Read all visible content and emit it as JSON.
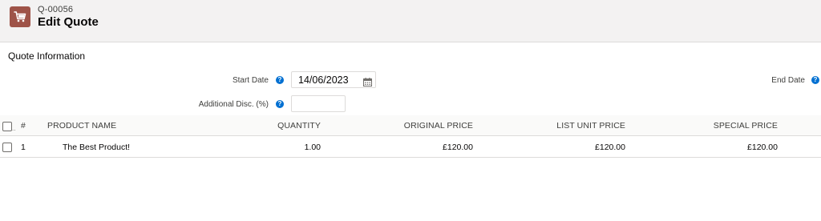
{
  "record": {
    "id": "Q-00056",
    "title": "Edit Quote",
    "icon": "cart-icon",
    "brand_color": "#9e5348"
  },
  "section": {
    "title": "Quote Information"
  },
  "fields": {
    "start_date": {
      "label": "Start Date",
      "value": "14/06/2023"
    },
    "end_date": {
      "label": "End Date"
    },
    "additional_disc": {
      "label": "Additional Disc. (%)",
      "value": ""
    }
  },
  "help_glyph": "?",
  "table": {
    "ellipsis": "..",
    "headers": [
      "#",
      "PRODUCT NAME",
      "QUANTITY",
      "ORIGINAL PRICE",
      "LIST UNIT PRICE",
      "SPECIAL PRICE"
    ],
    "rows": [
      {
        "num": "1",
        "product": "The Best Product!",
        "quantity": "1.00",
        "original_price": "£120.00",
        "list_unit_price": "£120.00",
        "special_price": "£120.00"
      }
    ]
  }
}
